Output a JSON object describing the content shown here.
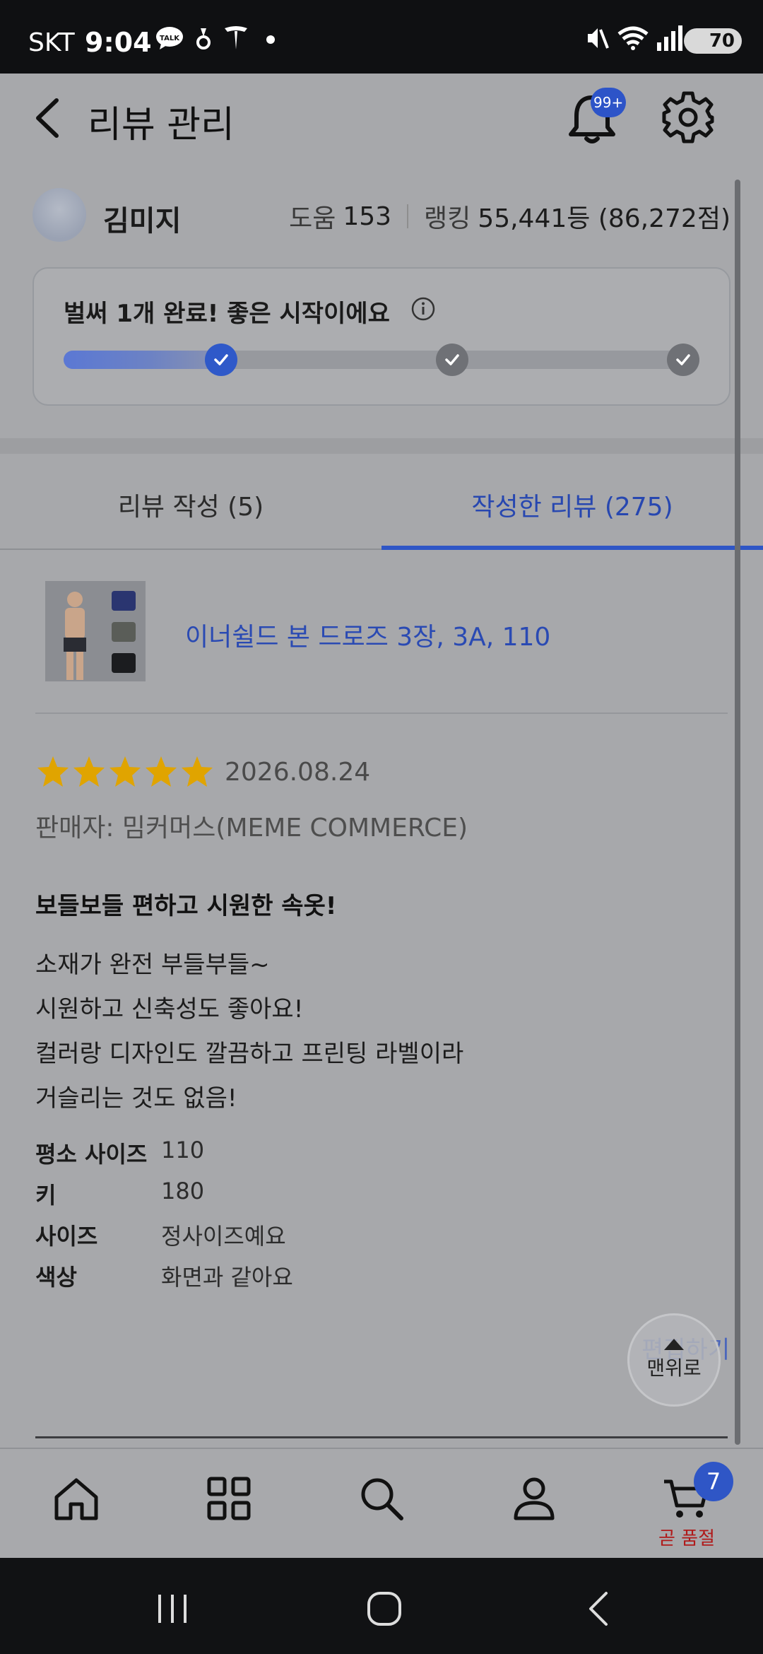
{
  "status_bar": {
    "carrier": "SKT",
    "time": "9:04",
    "battery": "70"
  },
  "header": {
    "title": "리뷰 관리",
    "notification_badge": "99+"
  },
  "profile": {
    "name": "김미지",
    "help_label": "도움",
    "help_count": "153",
    "ranking_label": "랭킹",
    "ranking_value": "55,441등 (86,272점)"
  },
  "progress": {
    "message": "벌써 1개 완료! 좋은 시작이에요",
    "completed_steps": 1,
    "total_steps": 3
  },
  "tabs": [
    {
      "label": "리뷰 작성 (5)",
      "active": false
    },
    {
      "label": "작성한 리뷰 (275)",
      "active": true
    }
  ],
  "review": {
    "product_name": "이너쉴드 본 드로즈 3장, 3A, 110",
    "rating": 5,
    "date": "2026.08.24",
    "seller": "판매자: 밈커머스(MEME COMMERCE)",
    "title": "보들보들 편하고 시원한 속옷!",
    "body_lines": [
      "소재가 완전 부들부들~",
      "시원하고 신축성도 좋아요!",
      "컬러랑 디자인도 깔끔하고 프린팅 라벨이라",
      "거슬리는 것도 없음!"
    ],
    "attributes": [
      {
        "key": "평소 사이즈",
        "value": "110"
      },
      {
        "key": "키",
        "value": "180"
      },
      {
        "key": "사이즈",
        "value": "정사이즈예요"
      },
      {
        "key": "색상",
        "value": "화면과 같아요"
      }
    ],
    "edit_label": "편집하기"
  },
  "scroll_top_label": "맨위로",
  "bottom_nav": {
    "items": [
      "home-icon",
      "category-icon",
      "search-icon",
      "profile-icon",
      "cart-icon"
    ],
    "cart_count": "7",
    "cart_notice": "곧 품절"
  },
  "colors": {
    "accent": "#2f56c6",
    "star": "#e0a400",
    "alert": "#b01a1a"
  }
}
